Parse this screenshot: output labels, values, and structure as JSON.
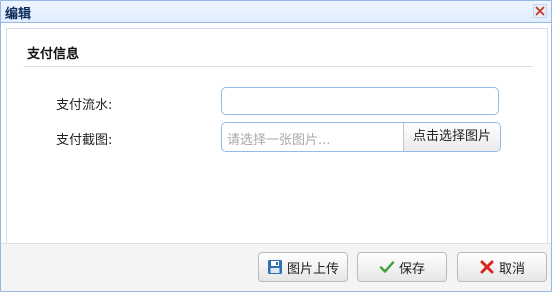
{
  "window": {
    "title": "编辑"
  },
  "section": {
    "title": "支付信息"
  },
  "form": {
    "serial_label": "支付流水:",
    "serial_value": "",
    "screenshot_label": "支付截图:",
    "screenshot_placeholder": "请选择一张图片...",
    "choose_button_label": "点击选择图片"
  },
  "footer": {
    "upload_label": "图片上传",
    "save_label": "保存",
    "cancel_label": "取消"
  },
  "icons": {
    "close": "close-icon",
    "upload": "floppy-disk-icon",
    "save": "checkmark-icon",
    "cancel": "x-icon"
  },
  "colors": {
    "border": "#95b8e7",
    "save_check": "#3aa33a",
    "cancel_x": "#d9251c",
    "floppy": "#2f6fb3"
  }
}
